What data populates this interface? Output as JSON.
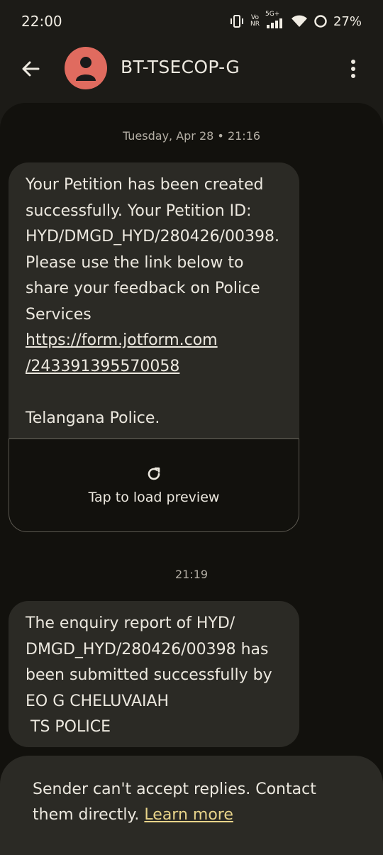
{
  "status_bar": {
    "time": "22:00",
    "volte_top": "Vo",
    "volte_bottom": "NR",
    "network": "5G+",
    "battery": "27%"
  },
  "header": {
    "contact_name": "BT-TSECOP-G"
  },
  "messages": [
    {
      "timestamp": "Tuesday, Apr 28 • 21:16",
      "text_before_link": "Your Petition has been created successfully. Your Petition ID: HYD/DMGD_HYD/280426/00398. Please use the link below to share your feedback on Police Services",
      "link_line1": "https://form.jotform.com",
      "link_line2": "/243391395570058",
      "signature": "Telangana Police.",
      "preview_label": "Tap to load preview"
    },
    {
      "timestamp": "21:19",
      "text": "The enquiry report of HYD/\nDMGD_HYD/280426/00398 has been submitted successfully by\nEO G CHELUVAIAH\n TS POLICE"
    }
  ],
  "footer": {
    "notice": "Sender can't accept replies. Contact them directly.",
    "learn_more": "Learn more"
  },
  "colors": {
    "avatar": "#e06b5f",
    "bubble": "#2b2a25",
    "link_accent": "#e8d48a"
  }
}
